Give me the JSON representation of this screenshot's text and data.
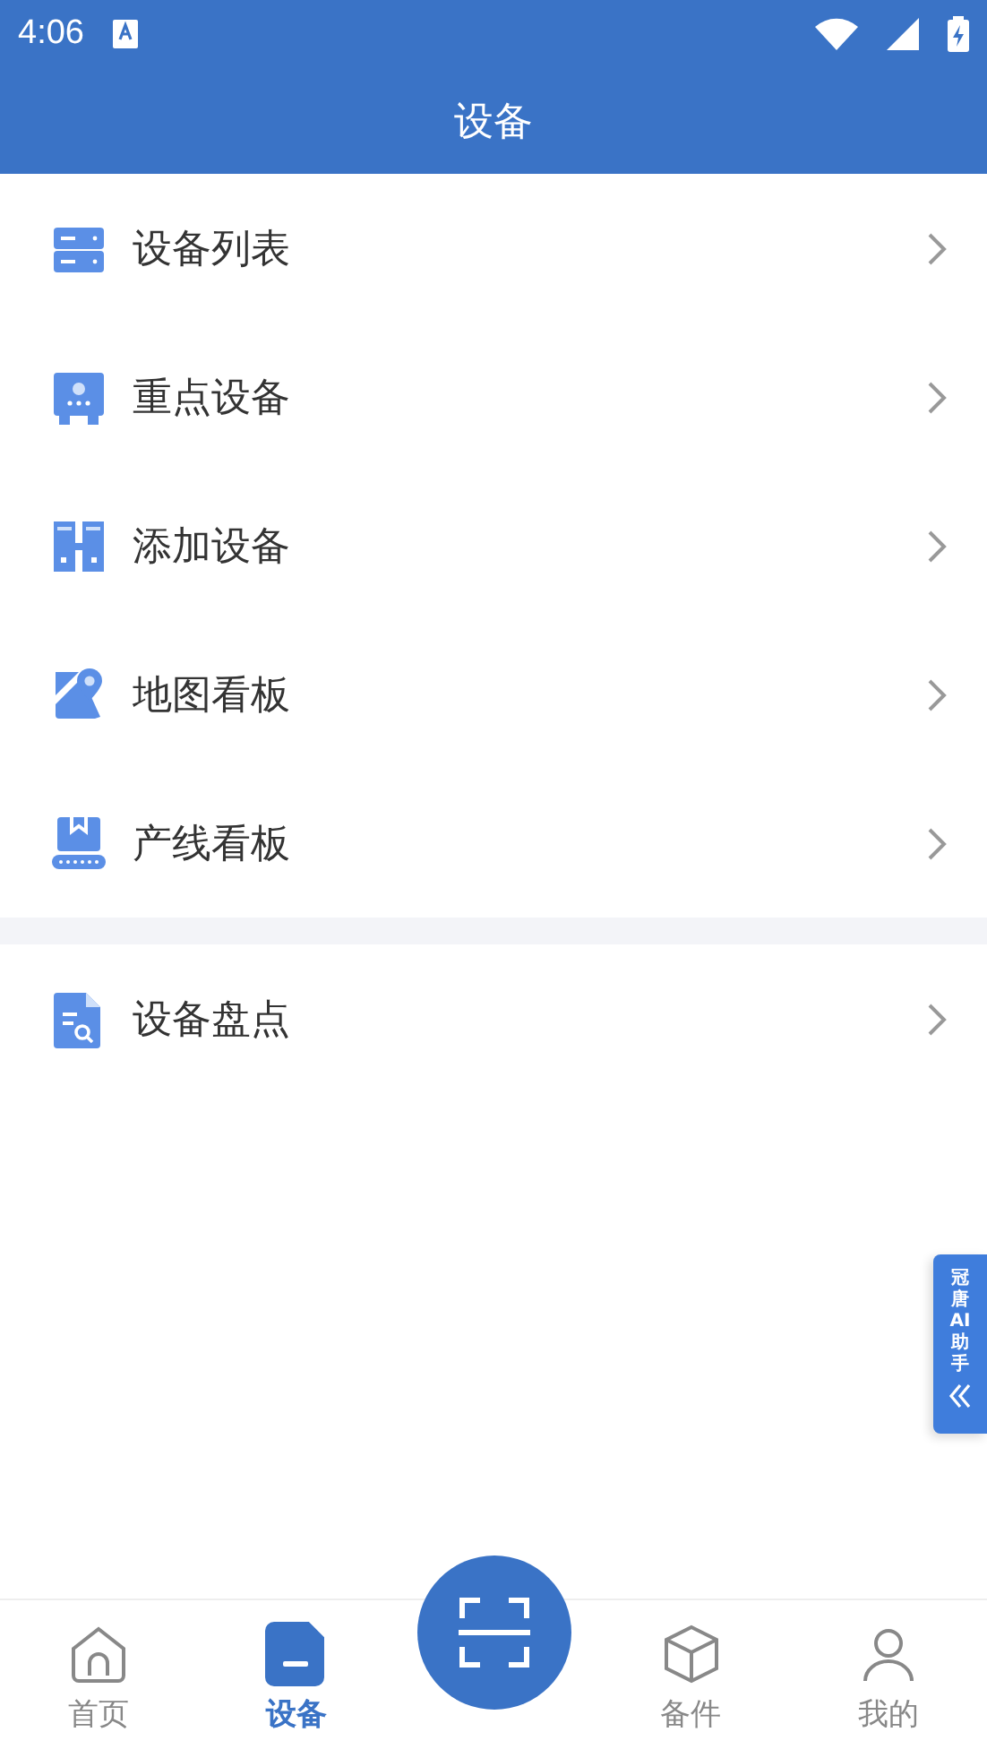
{
  "status_bar": {
    "time": "4:06"
  },
  "header": {
    "title": "设备"
  },
  "menu_groups": [
    {
      "items": [
        {
          "label": "设备列表"
        },
        {
          "label": "重点设备"
        },
        {
          "label": "添加设备"
        },
        {
          "label": "地图看板"
        },
        {
          "label": "产线看板"
        }
      ]
    },
    {
      "items": [
        {
          "label": "设备盘点"
        }
      ]
    }
  ],
  "assistant_tab": {
    "label": "冠唐AI助手"
  },
  "tab_bar": [
    {
      "kind": "tab",
      "label": "首页",
      "selected": false
    },
    {
      "kind": "tab",
      "label": "设备",
      "selected": true
    },
    {
      "kind": "scan"
    },
    {
      "kind": "tab",
      "label": "备件",
      "selected": false
    },
    {
      "kind": "tab",
      "label": "我的",
      "selected": false
    }
  ]
}
